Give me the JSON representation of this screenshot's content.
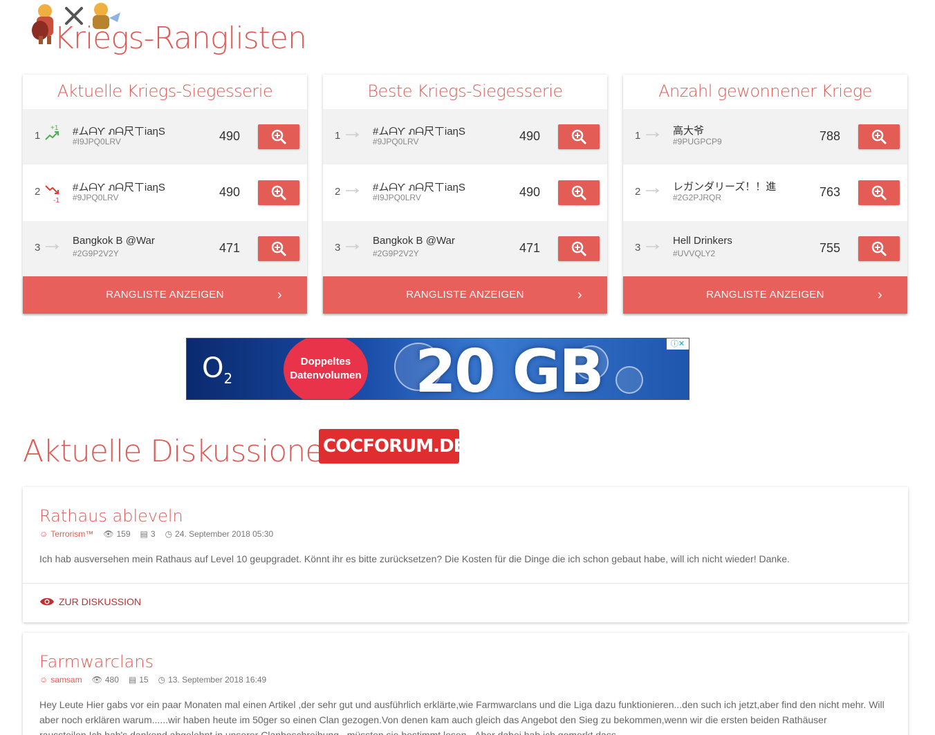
{
  "header": {
    "title": "Kriegs-Ranglisten"
  },
  "rankings": [
    {
      "title": "Aktuelle Kriegs-Siegesserie",
      "button_label": "RANGLISTE ANZEIGEN",
      "rows": [
        {
          "rank": "1",
          "trend": "up",
          "delta": "+1",
          "name": "#ムᗩƳ ภᗩ尺ㄒiaηS",
          "tag": "#I9JPQ0LRV",
          "score": "490"
        },
        {
          "rank": "2",
          "trend": "down",
          "delta": "-1",
          "name": "#ムᗩƳ ภᗩ尺ㄒiaηS",
          "tag": "#9JPQ0LRV",
          "score": "490"
        },
        {
          "rank": "3",
          "trend": "flat",
          "delta": "",
          "name": "Bangkok B @War",
          "tag": "#2G9P2V2Y",
          "score": "471"
        }
      ]
    },
    {
      "title": "Beste Kriegs-Siegesserie",
      "button_label": "RANGLISTE ANZEIGEN",
      "rows": [
        {
          "rank": "1",
          "trend": "flat",
          "delta": "",
          "name": "#ムᗩƳ ภᗩ尺ㄒiaηS",
          "tag": "#9JPQ0LRV",
          "score": "490"
        },
        {
          "rank": "2",
          "trend": "flat",
          "delta": "",
          "name": "#ムᗩƳ ภᗩ尺ㄒiaηS",
          "tag": "#I9JPQ0LRV",
          "score": "490"
        },
        {
          "rank": "3",
          "trend": "flat",
          "delta": "",
          "name": "Bangkok B @War",
          "tag": "#2G9P2V2Y",
          "score": "471"
        }
      ]
    },
    {
      "title": "Anzahl gewonnener Kriege",
      "button_label": "RANGLISTE ANZEIGEN",
      "rows": [
        {
          "rank": "1",
          "trend": "flat",
          "delta": "",
          "name": "高大爷",
          "tag": "#9PUGPCP9",
          "score": "788"
        },
        {
          "rank": "2",
          "trend": "flat",
          "delta": "",
          "name": "レガンダリーズ！！進",
          "tag": "#2G2PJRQR",
          "score": "763"
        },
        {
          "rank": "3",
          "trend": "flat",
          "delta": "",
          "name": "Hell Drinkers",
          "tag": "#UVVQLY2",
          "score": "755"
        }
      ]
    }
  ],
  "ad": {
    "brand": "O",
    "brand_sub": "2",
    "badge_line1": "Doppeltes",
    "badge_line2": "Datenvolumen",
    "headline": "20 GB"
  },
  "discussions": {
    "title": "Aktuelle Diskussionen",
    "forum_badge": "COCFORUM.DE",
    "posts": [
      {
        "title": "Rathaus ableveln",
        "author": "Terrorism™",
        "views": "159",
        "replies": "3",
        "date": "24. September 2018 05:30",
        "text": "Ich hab ausversehen mein Rathaus auf Level 10 geupgradet. Könnt ihr es bitte zurücksetzen? Die Kosten für die Dinge die ich schon gebaut habe, will ich nicht wieder! Danke.",
        "link_label": "ZUR DISKUSSION"
      },
      {
        "title": "Farmwarclans",
        "author": "samsam",
        "views": "480",
        "replies": "15",
        "date": "13. September 2018 16:49",
        "text": "Hey Leute Hier gabs vor ein paar Monaten mal einen Artikel ,der sehr gut und ausführlich erklärte,wie Farmwarclans und die Liga dazu funktionieren...den such ich jetzt,aber find den nicht mehr. Will aber noch erklären warum......wir haben heute im 50ger so einen Clan gezogen.Von denen kam auch gleich das Angebot den Sieg zu bekommen,wenn wir die ersten beiden Rathäuser raussteilen.Ich hab's dankend abgelehnt in unserer Clanbeschreibung...müssten sie bestimmt lesen...Aber dabei hab ich gemerkt dass"
      }
    ]
  },
  "colors": {
    "accent": "#e05a55",
    "button": "#e8605b",
    "up": "#4caf50",
    "down": "#e53935"
  }
}
